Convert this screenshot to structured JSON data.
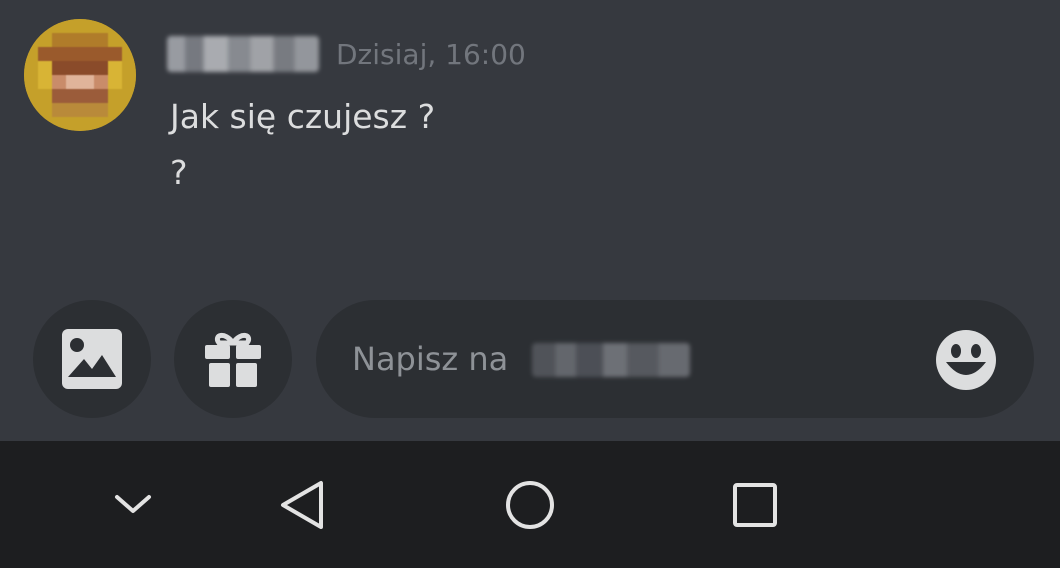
{
  "message": {
    "timestamp": "Dzisiaj, 16:00",
    "lines": [
      "Jak się czujesz ?",
      "?"
    ]
  },
  "composer": {
    "placeholder_prefix": "Napisz na",
    "image_button_icon": "image-icon",
    "gift_button_icon": "gift-icon",
    "emoji_button_icon": "smiley-emoji-icon"
  },
  "nav": {
    "icons": [
      "chevron-down-icon",
      "back-triangle-icon",
      "home-circle-icon",
      "recents-square-icon"
    ]
  },
  "colors": {
    "background": "#36393f",
    "input_bg": "#2c2f33",
    "nav_bg": "#1d1e20",
    "text": "#dcddde",
    "muted": "#72767d"
  }
}
